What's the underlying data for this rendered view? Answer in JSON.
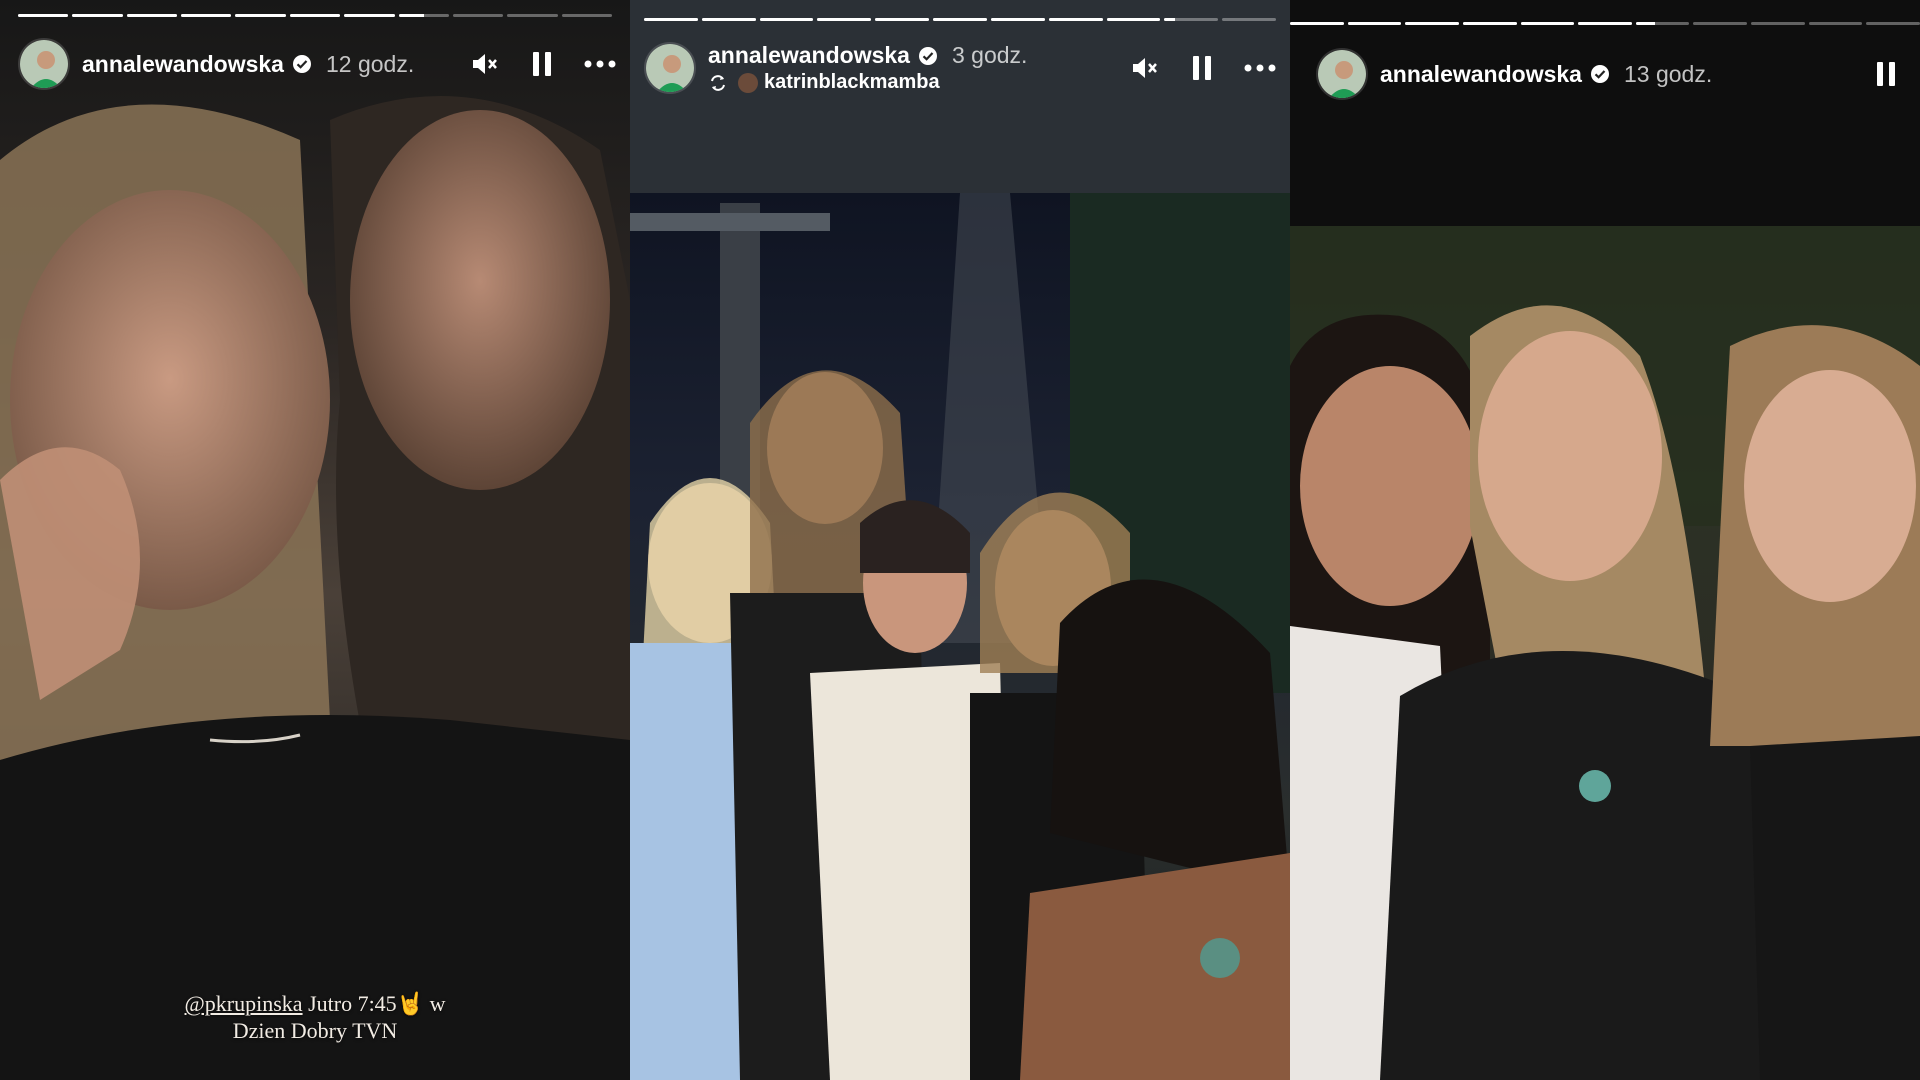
{
  "stories": [
    {
      "username": "annalewandowska",
      "time": "12 godz.",
      "progress": {
        "total": 11,
        "completed": 7,
        "current_fraction": 0.5
      },
      "caption": {
        "mention": "@pkrupinska",
        "line1_rest": "Jutro 7:45🤘 w",
        "line2": "Dzien Dobry TVN"
      }
    },
    {
      "username": "annalewandowska",
      "time": "3 godz.",
      "reposted_from": "katrinblackmamba",
      "progress": {
        "total": 11,
        "completed": 9,
        "current_fraction": 0.2
      }
    },
    {
      "username": "annalewandowska",
      "time": "13 godz.",
      "progress": {
        "total": 11,
        "completed": 6,
        "current_fraction": 0.35
      }
    }
  ],
  "icons": {
    "mute": "speaker-muted-icon",
    "pause": "pause-icon",
    "more": "more-dots-icon",
    "verified": "verified-badge-icon",
    "repost": "repost-icon"
  },
  "colors": {
    "verified": "#3897f0",
    "progress_active": "#ffffff",
    "progress_inactive": "rgba(255,255,255,0.35)"
  }
}
